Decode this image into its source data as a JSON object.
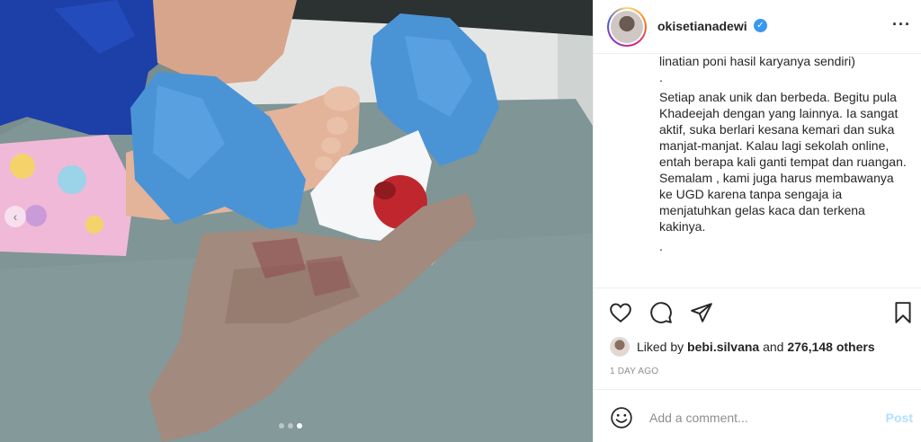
{
  "post": {
    "username": "okisetianadewi",
    "verified_label": "✓",
    "more_label": "···",
    "caption_lines": [
      "linatian poni hasil karyanya sendiri)",
      ".",
      "Setiap anak unik dan berbeda. Begitu pula Khadeejah dengan yang lainnya. Ia sangat aktif, suka berlari kesana kemari dan suka manjat-manjat. Kalau lagi sekolah online, entah berapa kali ganti tempat dan ruangan. Semalam , kami juga harus membawanya ke UGD karena tanpa sengaja ia menjatuhkan gelas kaca dan terkena kakinya.",
      "."
    ],
    "likes": {
      "prefix": "Liked by",
      "user": "bebi.silvana",
      "middle": "and",
      "count": "276,148 others"
    },
    "timestamp": "1 DAY AGO",
    "comment": {
      "placeholder": "Add a comment...",
      "post_label": "Post"
    },
    "carousel": {
      "prev_label": "‹",
      "count": 3,
      "active_index": 2
    }
  },
  "colors": {
    "verified": "#3897f0",
    "post_disabled": "#b2dffc",
    "glove": "#4a94d6",
    "scrub": "#1d3fa8"
  },
  "icons": [
    "heart-icon",
    "comment-icon",
    "share-icon",
    "bookmark-icon",
    "emoji-icon",
    "verified-icon",
    "more-icon",
    "chevron-left-icon"
  ]
}
